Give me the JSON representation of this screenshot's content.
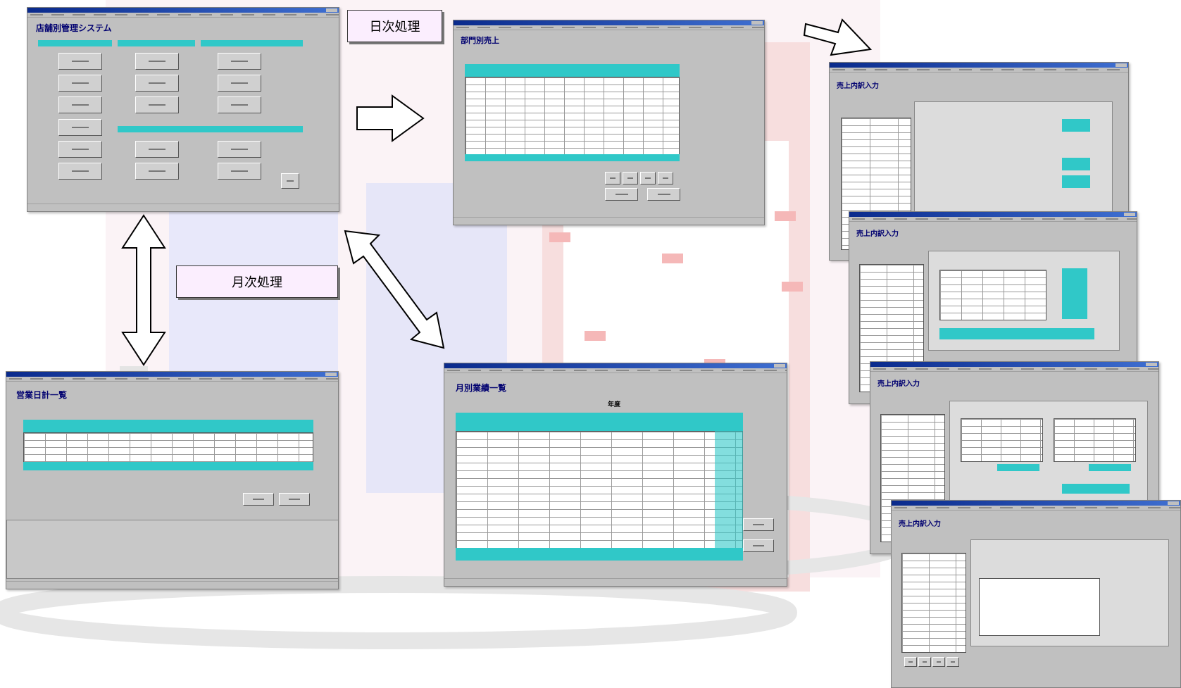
{
  "labels": {
    "daily": "日次処理",
    "monthly": "月次処理"
  },
  "windows": {
    "main_menu": {
      "title": "店舗別管理システム"
    },
    "dept_sales": {
      "title": "部門別売上"
    },
    "monthly_list": {
      "title": "営業日計一覧"
    },
    "month_results": {
      "title": "月別業績一覧",
      "year_label": "年度"
    },
    "sales_entry_1": {
      "title": "売上内訳入力"
    },
    "sales_entry_2": {
      "title": "売上内訳入力"
    },
    "sales_entry_3": {
      "title": "売上内訳入力"
    },
    "sales_entry_4": {
      "title": "売上内訳入力"
    }
  },
  "colors": {
    "accent": "#30c8c8",
    "window": "#c0c0c0",
    "titlebar": "#0a2a8c",
    "label_bg": "#fbeefe"
  }
}
